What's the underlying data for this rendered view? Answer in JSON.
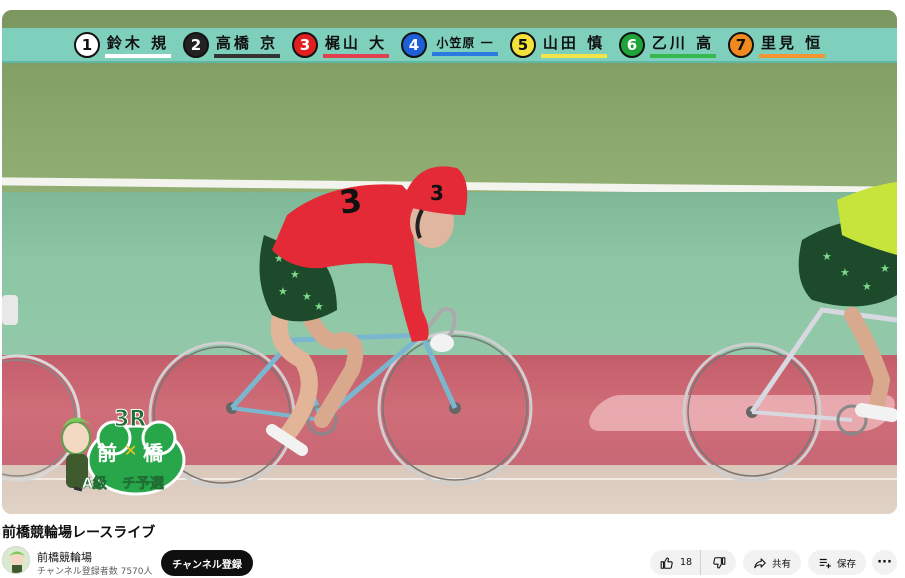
{
  "banner": {
    "riders": [
      {
        "num": "1",
        "name": "鈴木 規",
        "bg": "#ffffff",
        "fg": "#111111",
        "bar": "#ffffff"
      },
      {
        "num": "2",
        "name": "高橋 京",
        "bg": "#222222",
        "fg": "#ffffff",
        "bar": "#333333"
      },
      {
        "num": "3",
        "name": "梶山 大",
        "bg": "#e02020",
        "fg": "#ffffff",
        "bar": "#e04050"
      },
      {
        "num": "4",
        "name": "小笠原 一",
        "bg": "#1d5fd6",
        "fg": "#ffffff",
        "bar": "#2a7be0"
      },
      {
        "num": "5",
        "name": "山田 慎",
        "bg": "#f3e23a",
        "fg": "#111111",
        "bar": "#f1e54a"
      },
      {
        "num": "6",
        "name": "乙川 高",
        "bg": "#1ea33a",
        "fg": "#ffffff",
        "bar": "#37b84d"
      },
      {
        "num": "7",
        "name": "里見 恒",
        "bg": "#f08a1e",
        "fg": "#111111",
        "bar": "#f39532"
      }
    ]
  },
  "jersey_number": "3",
  "logo": {
    "race": "3R",
    "track": "前",
    "track2": "橋",
    "class": "A級",
    "stage": "チ予選"
  },
  "video": {
    "title": "前橋競輪場レースライブ",
    "channel_name": "前橋競輪場",
    "subscribers": "チャンネル登録者数 7570人",
    "subscribe_label": "チャンネル登録",
    "like_count": "18",
    "share_label": "共有",
    "save_label": "保存",
    "more_label": "···"
  },
  "icons": {
    "like": "thumbs-up-icon",
    "dislike": "thumbs-down-icon",
    "share": "share-arrow-icon",
    "save": "playlist-add-icon",
    "more": "more-horizontal-icon"
  }
}
